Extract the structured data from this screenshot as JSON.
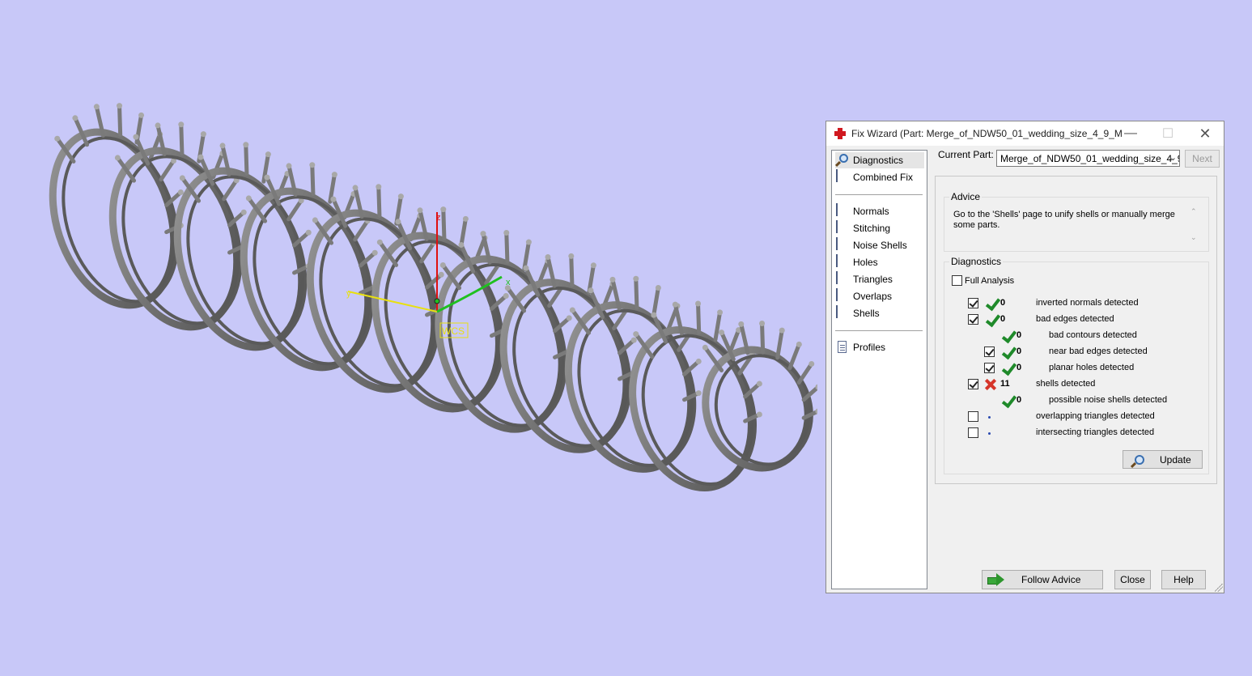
{
  "viewport": {
    "background": "#c8c8f8",
    "axis_labels": {
      "x": "x",
      "y": "y",
      "z": "z"
    },
    "wcs_label": "WCS"
  },
  "dialog": {
    "title": "Fix Wizard (Part: Merge_of_NDW50_01_wedding_size_4_9_M...",
    "nav": {
      "items_top": [
        {
          "label": "Diagnostics",
          "icon": "magnifier-icon",
          "selected": true
        },
        {
          "label": "Combined Fix",
          "icon": "combined-fix-icon"
        }
      ],
      "items_middle": [
        {
          "label": "Normals",
          "icon": "normals-icon"
        },
        {
          "label": "Stitching",
          "icon": "stitching-icon"
        },
        {
          "label": "Noise Shells",
          "icon": "noise-shells-icon"
        },
        {
          "label": "Holes",
          "icon": "holes-icon"
        },
        {
          "label": "Triangles",
          "icon": "triangles-icon"
        },
        {
          "label": "Overlaps",
          "icon": "overlaps-icon"
        },
        {
          "label": "Shells",
          "icon": "shells-icon"
        }
      ],
      "items_bottom": [
        {
          "label": "Profiles",
          "icon": "profiles-icon"
        }
      ]
    },
    "current_part_label": "Current Part:",
    "current_part_value": "Merge_of_NDW50_01_wedding_size_4_9_",
    "next_label": "Next",
    "advice": {
      "title": "Advice",
      "text": "Go to the 'Shells' page to unify shells or manually merge some parts."
    },
    "diagnostics": {
      "title": "Diagnostics",
      "full_analysis_label": "Full Analysis",
      "rows": [
        {
          "checkbox": "checked",
          "status": "ok",
          "count": "0",
          "label": "inverted normals detected",
          "indent": 0
        },
        {
          "checkbox": "checked",
          "status": "ok",
          "count": "0",
          "label": "bad edges detected",
          "indent": 0
        },
        {
          "checkbox": "none",
          "status": "ok",
          "count": "0",
          "label": "bad contours detected",
          "indent": 1
        },
        {
          "checkbox": "checked",
          "status": "ok",
          "count": "0",
          "label": "near bad edges detected",
          "indent": 1
        },
        {
          "checkbox": "checked",
          "status": "ok",
          "count": "0",
          "label": "planar holes detected",
          "indent": 1
        },
        {
          "checkbox": "checked",
          "status": "error",
          "count": "11",
          "label": "shells detected",
          "indent": 0
        },
        {
          "checkbox": "none",
          "status": "ok",
          "count": "0",
          "label": "possible noise shells detected",
          "indent": 1
        },
        {
          "checkbox": "unchecked",
          "status": "pending",
          "count": "",
          "label": "overlapping triangles detected",
          "indent": 0
        },
        {
          "checkbox": "unchecked",
          "status": "pending",
          "count": "",
          "label": "intersecting triangles detected",
          "indent": 0
        }
      ],
      "update_label": "Update"
    },
    "buttons": {
      "follow_advice": "Follow Advice",
      "close": "Close",
      "help": "Help"
    },
    "colors": {
      "ok": "#1f8a2a",
      "error": "#d6352a",
      "pending": "#2a4ab0",
      "accent_red": "#d0181f"
    }
  }
}
